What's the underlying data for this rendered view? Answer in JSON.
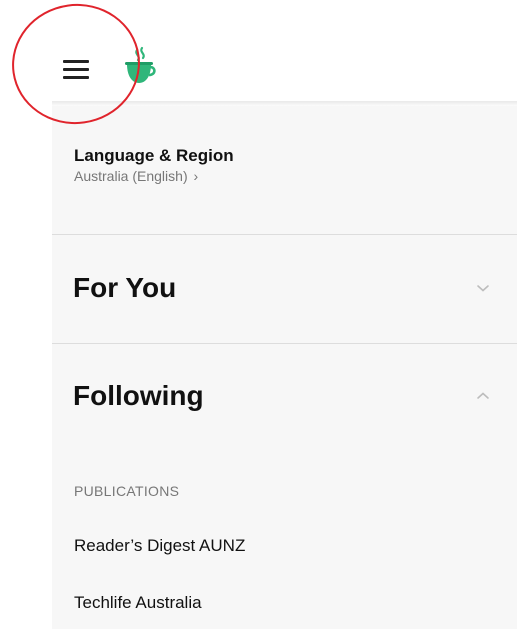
{
  "header": {
    "menu_icon": "hamburger-menu-icon",
    "logo_icon": "coffee-cup-logo-icon",
    "brand_color": "#2fb67a",
    "annotation_color": "#e0242c"
  },
  "language_region": {
    "title": "Language & Region",
    "value": "Australia (English)",
    "chevron": "›"
  },
  "sections": [
    {
      "label": "For You",
      "state": "collapsed",
      "chevron_icon": "chevron-down-icon"
    },
    {
      "label": "Following",
      "state": "expanded",
      "chevron_icon": "chevron-up-icon"
    }
  ],
  "following": {
    "publications_header": "PUBLICATIONS",
    "publications": [
      "Reader’s Digest AUNZ",
      "Techlife Australia"
    ]
  }
}
